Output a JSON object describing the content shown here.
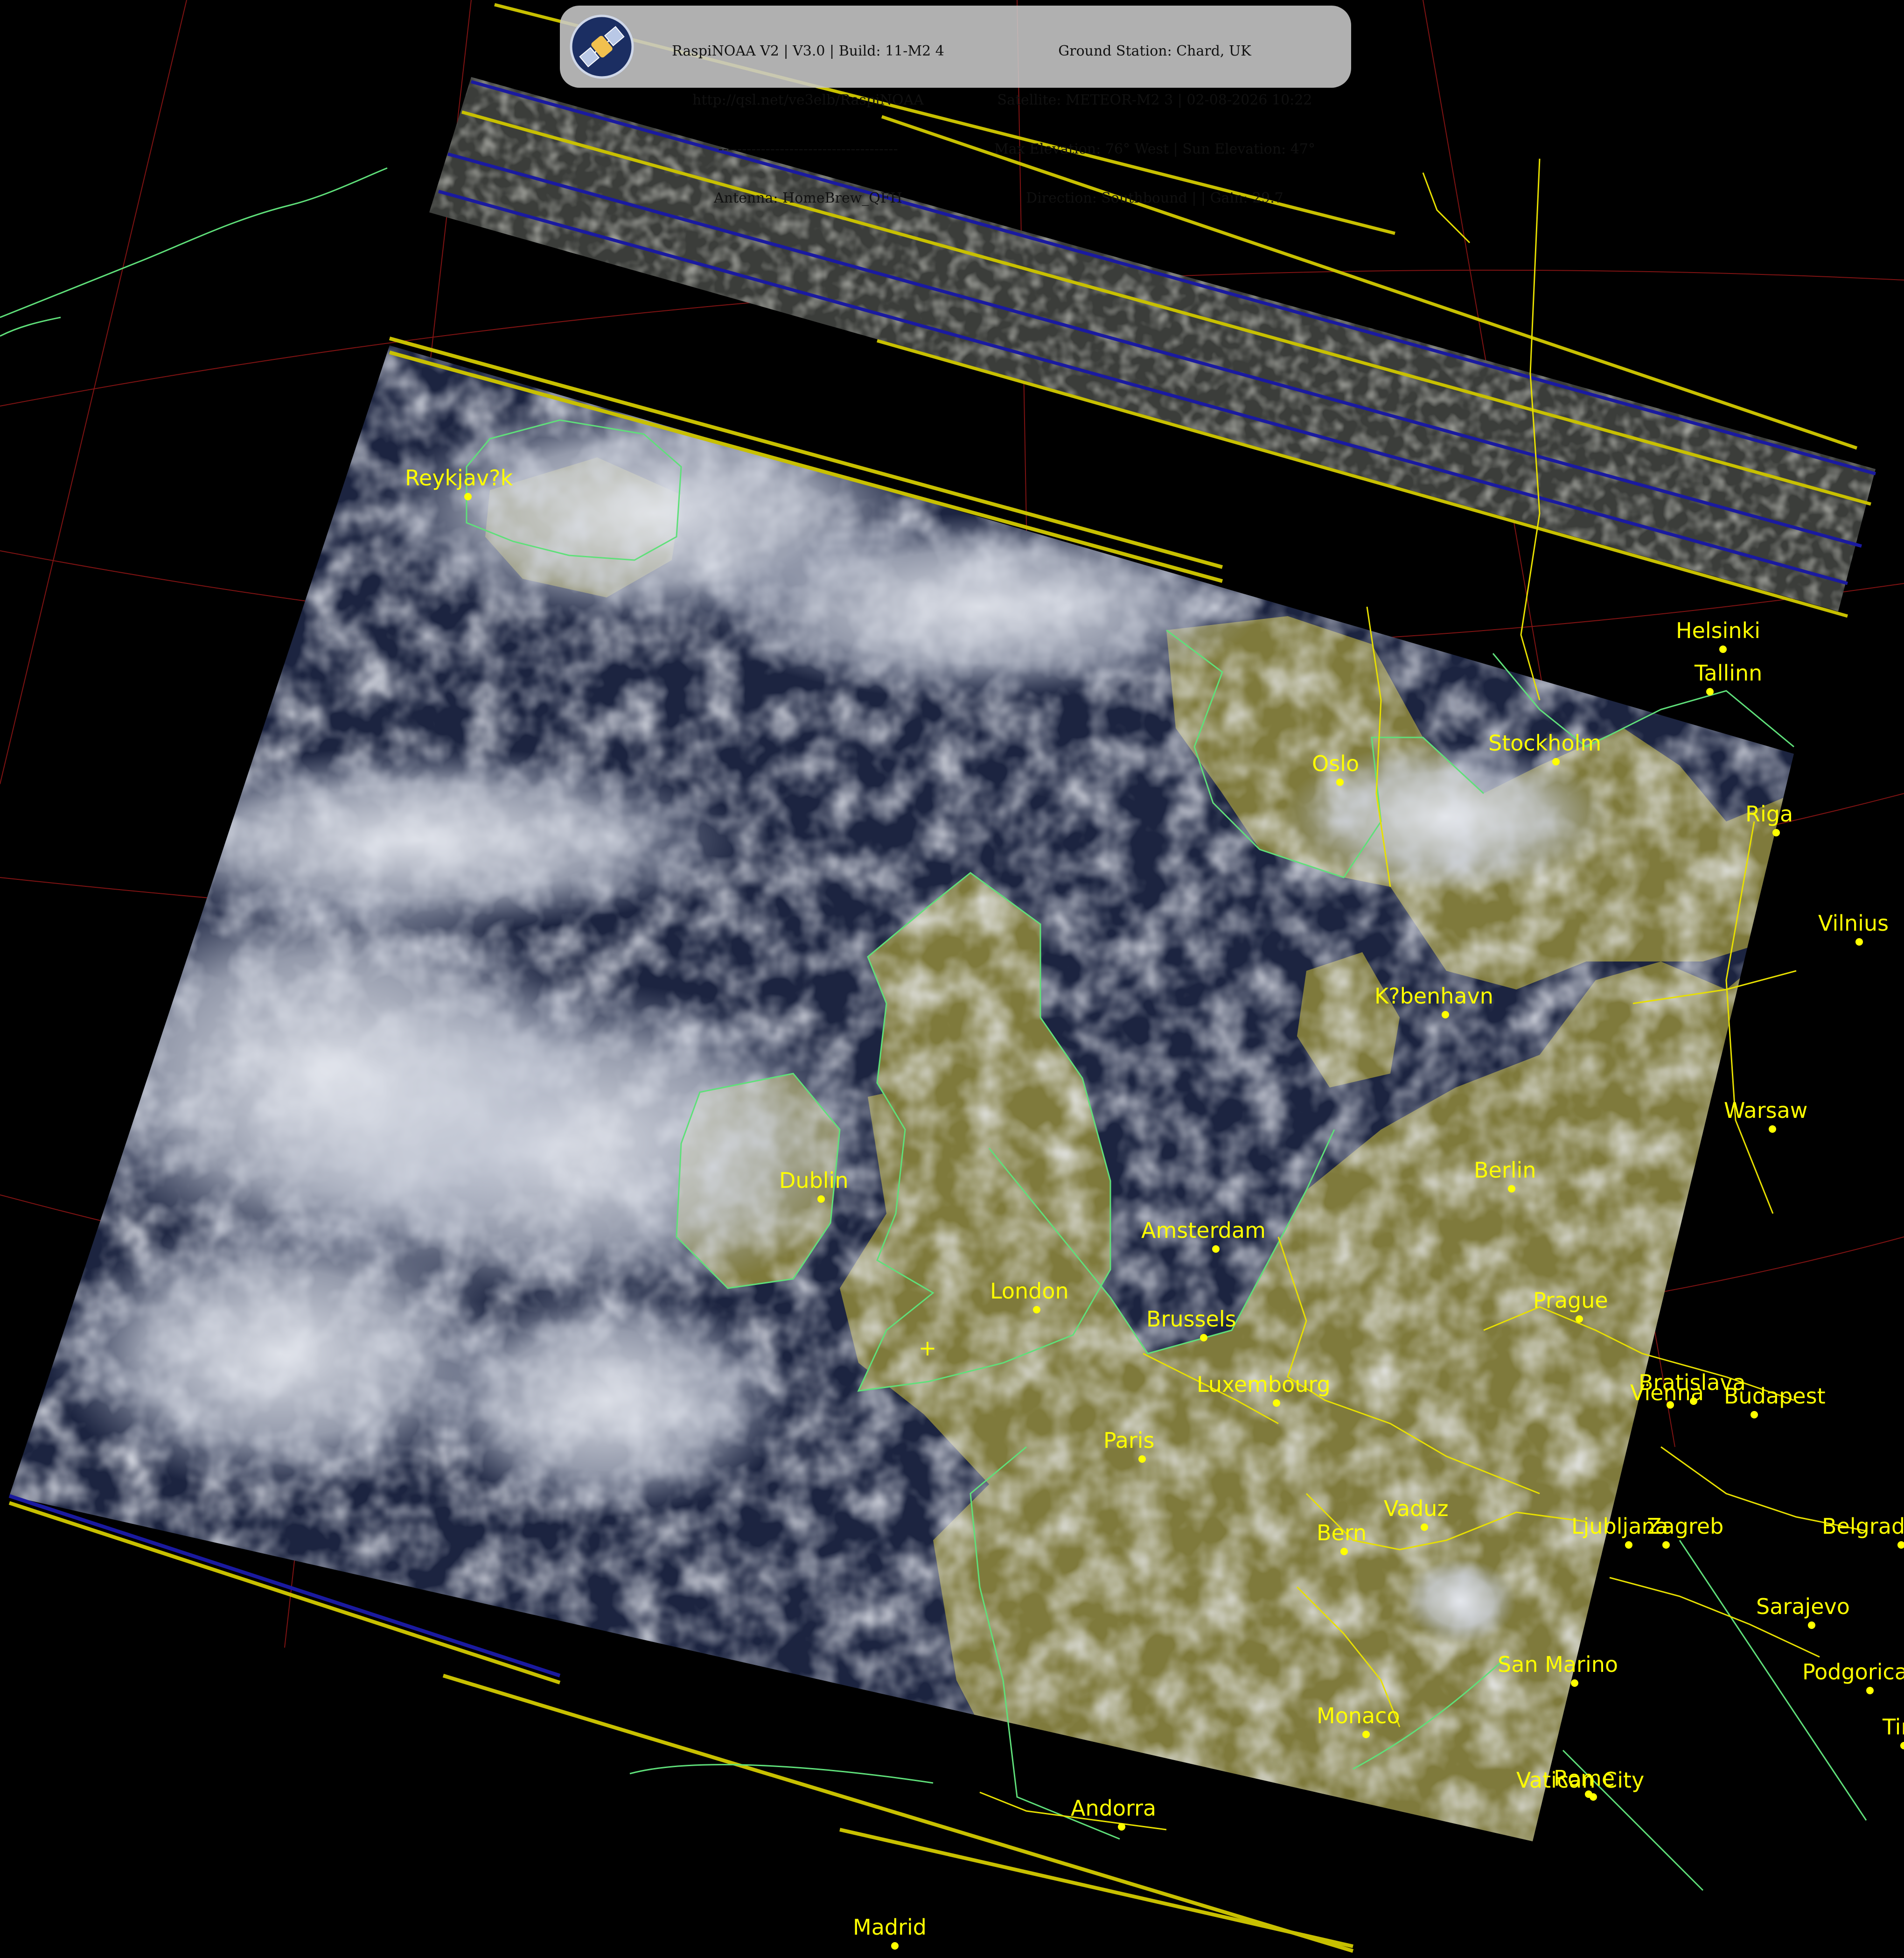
{
  "info_panel": {
    "left_lines": [
      "RaspiNOAA V2 | V3.0 | Build: 11-M2 4",
      "http://qsl.net/ve3elb/RaspiNOAA",
      "--------------------------------------",
      "Antenna: HomeBrew_QFH"
    ],
    "right_lines": [
      "Ground Station: Chard, UK",
      "Satellite: METEOR-M2 3 | 02-08-2026 10:22",
      "Max Elevation: 76° West | Sun Elevation: 47°",
      "Direction: Southbound | | Gain: 29.7"
    ],
    "logo_icon": "satellite-icon"
  },
  "colors": {
    "coastline": "#5fe07a",
    "border": "#e8e000",
    "graticule": "#a01818",
    "city": "#ffff00",
    "background": "#000000",
    "land": "#7f7a3c",
    "ocean": "#1c2440",
    "cloud": "#d4d8e4"
  },
  "map": {
    "ground_station_marker": "+",
    "cities": [
      {
        "name": "Reykjav?k"
      },
      {
        "name": "Helsinki"
      },
      {
        "name": "Tallinn"
      },
      {
        "name": "Oslo"
      },
      {
        "name": "Stockholm"
      },
      {
        "name": "Riga"
      },
      {
        "name": "Vilnius"
      },
      {
        "name": "K?benhavn"
      },
      {
        "name": "Warsaw"
      },
      {
        "name": "Berlin"
      },
      {
        "name": "Dublin"
      },
      {
        "name": "Amsterdam"
      },
      {
        "name": "London"
      },
      {
        "name": "Brussels"
      },
      {
        "name": "Prague"
      },
      {
        "name": "Luxembourg"
      },
      {
        "name": "Bratislava"
      },
      {
        "name": "Vienna"
      },
      {
        "name": "Budapest"
      },
      {
        "name": "Paris"
      },
      {
        "name": "Vaduz"
      },
      {
        "name": "Bern"
      },
      {
        "name": "Ljubljana"
      },
      {
        "name": "Zagreb"
      },
      {
        "name": "Belgrade"
      },
      {
        "name": "Sarajevo"
      },
      {
        "name": "San Marino"
      },
      {
        "name": "Podgorica"
      },
      {
        "name": "Monaco"
      },
      {
        "name": "Vatican City"
      },
      {
        "name": "Rome"
      },
      {
        "name": "Tirana"
      },
      {
        "name": "Andorra"
      },
      {
        "name": "Madrid"
      }
    ]
  }
}
